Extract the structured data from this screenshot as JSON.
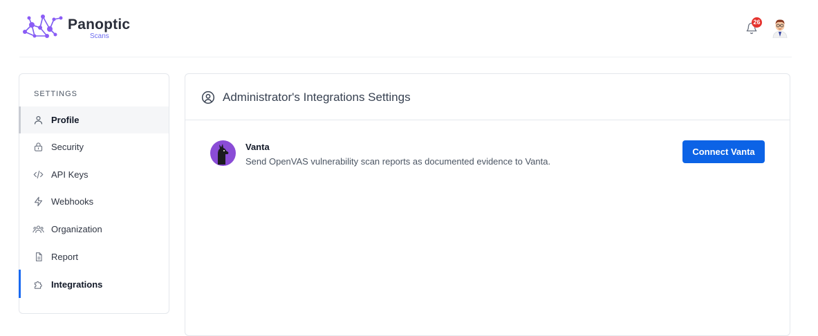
{
  "brand": {
    "title": "Panoptic",
    "subtitle": "Scans"
  },
  "header": {
    "notification_count": "26"
  },
  "sidebar": {
    "heading": "SETTINGS",
    "items": [
      {
        "label": "Profile",
        "icon": "user-icon"
      },
      {
        "label": "Security",
        "icon": "lock-icon"
      },
      {
        "label": "API Keys",
        "icon": "code-icon"
      },
      {
        "label": "Webhooks",
        "icon": "bolt-icon"
      },
      {
        "label": "Organization",
        "icon": "users-icon"
      },
      {
        "label": "Report",
        "icon": "document-icon"
      },
      {
        "label": "Integrations",
        "icon": "puzzle-icon"
      }
    ]
  },
  "main": {
    "title": "Administrator's Integrations Settings",
    "integrations": [
      {
        "name": "Vanta",
        "description": "Send OpenVAS vulnerability scan reports as documented evidence to Vanta.",
        "button_label": "Connect Vanta"
      }
    ]
  },
  "colors": {
    "accent": "#0c63e6",
    "badge": "#e5322d",
    "vanta": "#8a4cd6",
    "brand": "#6d6cf0"
  }
}
